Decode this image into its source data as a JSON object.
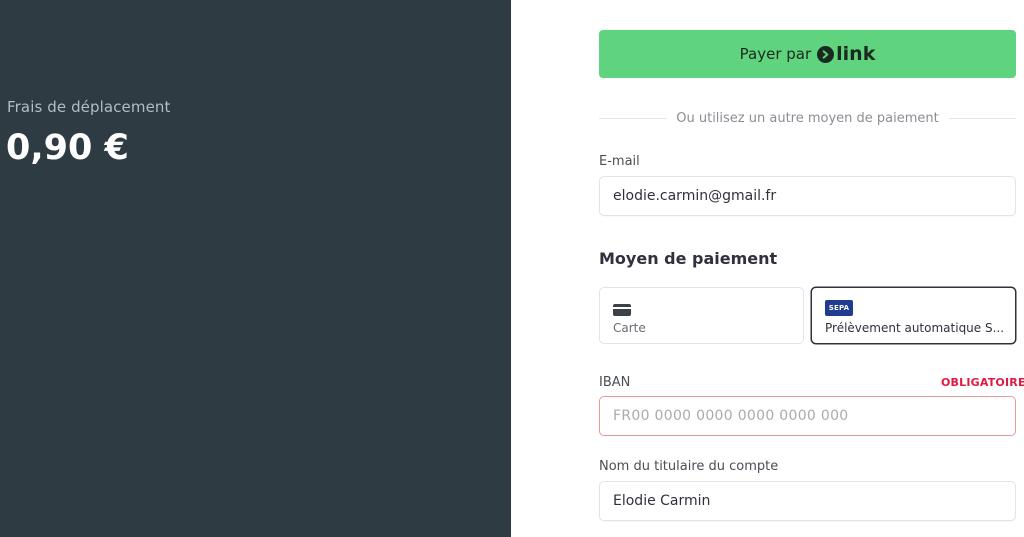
{
  "summary": {
    "label": "Frais de déplacement",
    "amount": "0,90 €"
  },
  "link_button": {
    "label": "Payer par",
    "brand": "link",
    "color": "#5fd37d"
  },
  "divider": {
    "text": "Ou utilisez un autre moyen de paiement"
  },
  "email": {
    "label": "E-mail",
    "value": "elodie.carmin@gmail.fr"
  },
  "payment_method": {
    "title": "Moyen de paiement",
    "tabs": [
      {
        "label": "Carte",
        "icon": "credit-card-icon",
        "selected": false
      },
      {
        "label": "Prélèvement automatique S...",
        "icon": "sepa-icon",
        "icon_text": "SEPA",
        "selected": true
      }
    ]
  },
  "iban": {
    "label": "IBAN",
    "required": "OBLIGATOIRE",
    "placeholder": "FR00 0000 0000 0000 0000 000",
    "error_color": "#df1b41"
  },
  "account_holder": {
    "label": "Nom du titulaire du compte",
    "value": "Elodie Carmin"
  }
}
